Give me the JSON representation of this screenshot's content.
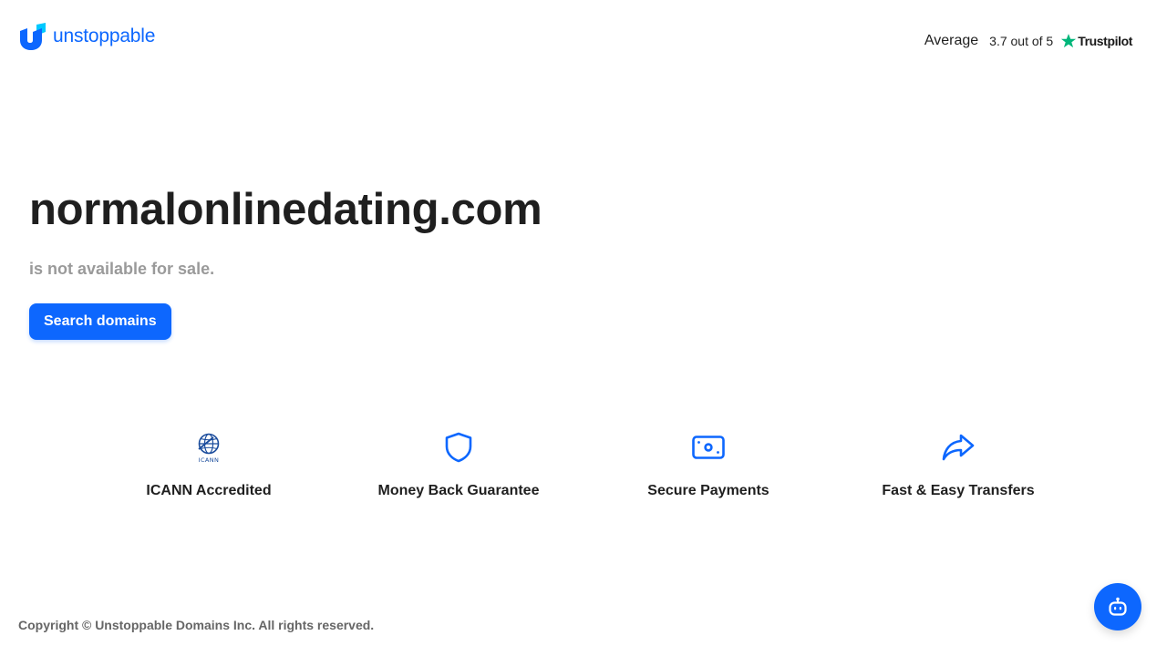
{
  "header": {
    "logo": {
      "text": "unstoppable",
      "icon": "unstoppable-logo-icon"
    },
    "trustpilot": {
      "rating_word": "Average",
      "score": "3.7 out of 5",
      "brand": "Trustpilot",
      "icon": "trustpilot-star-icon",
      "star_color": "#00b67a"
    }
  },
  "hero": {
    "domain": "normalonlinedating.com",
    "status": "is not available for sale.",
    "search_button": "Search domains"
  },
  "features": [
    {
      "icon": "icann-logo-icon",
      "label": "ICANN Accredited"
    },
    {
      "icon": "shield-icon",
      "label": "Money Back Guarantee"
    },
    {
      "icon": "banknote-icon",
      "label": "Secure Payments"
    },
    {
      "icon": "share-arrow-icon",
      "label": "Fast & Easy Transfers"
    }
  ],
  "footer": {
    "copyright": "Copyright © Unstoppable Domains Inc. All rights reserved."
  },
  "chat": {
    "icon": "chatbot-robot-icon"
  },
  "colors": {
    "accent": "#0d67fe",
    "muted_text": "#9a9a9a",
    "footer_text": "#666666"
  }
}
